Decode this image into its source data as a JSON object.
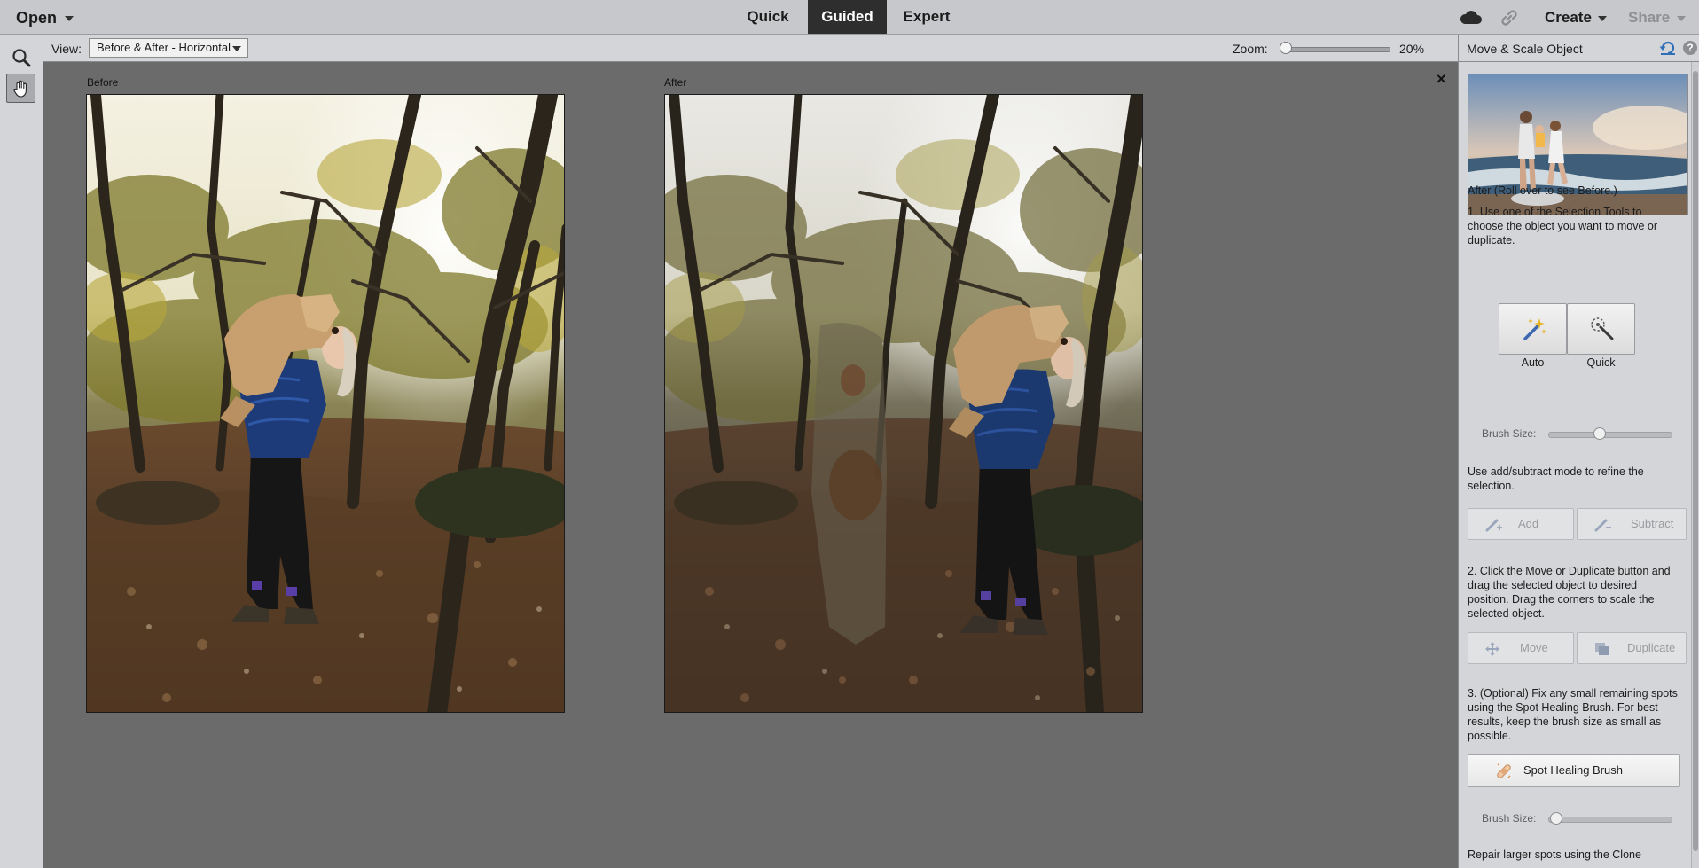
{
  "topbar": {
    "open_label": "Open",
    "modes": {
      "quick": "Quick",
      "guided": "Guided",
      "expert": "Expert"
    },
    "active_mode": "Guided",
    "create_label": "Create",
    "share_label": "Share"
  },
  "tools": [
    {
      "name": "zoom-tool",
      "icon": "magnifier-icon"
    },
    {
      "name": "hand-tool",
      "icon": "hand-icon",
      "active": true
    }
  ],
  "optionbar": {
    "view_label": "View:",
    "view_value": "Before & After - Horizontal",
    "zoom_label": "Zoom:",
    "zoom_value": "20%"
  },
  "canvas": {
    "before_label": "Before",
    "after_label": "After",
    "close_glyph": "×"
  },
  "panel": {
    "title": "Move & Scale Object",
    "help_glyph": "?",
    "preview_caption": "After (Roll over to see Before.)",
    "step1": "1. Use one of the Selection Tools to choose the object you want to move or duplicate.",
    "selection_tools": {
      "auto": "Auto",
      "quick": "Quick"
    },
    "brush_size_label": "Brush Size:",
    "refine_text": "Use add/subtract mode to refine the selection.",
    "add_label": "Add",
    "subtract_label": "Subtract",
    "step2": "2. Click the Move or Duplicate button and drag the selected object to desired position. Drag the corners to scale the selected object.",
    "move_label": "Move",
    "duplicate_label": "Duplicate",
    "step3": "3. (Optional) Fix any small remaining spots using the Spot Healing Brush. For best results, keep the brush size as small as possible.",
    "spot_healing_label": "Spot Healing Brush",
    "brush_size_label_2": "Brush Size:",
    "clone_text": "Repair larger spots using the Clone"
  },
  "colors": {
    "active_mode_bg": "#2e2e2e",
    "canvas_bg": "#6b6b6b",
    "panel_bg": "#d4d5d8",
    "reset_icon_color": "#2f6fb8"
  }
}
